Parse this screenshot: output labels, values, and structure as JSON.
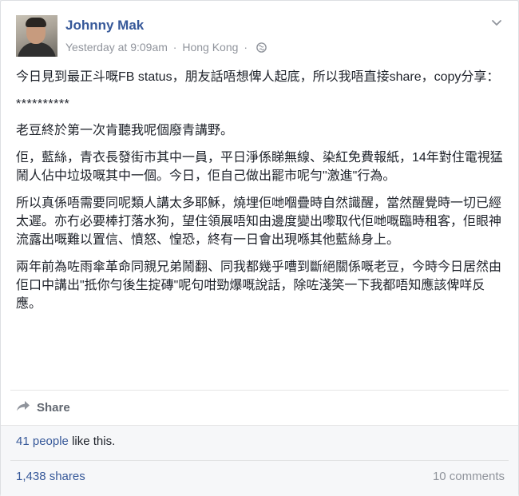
{
  "post": {
    "author": "Johnny Mak",
    "time": "Yesterday at 9:09am",
    "separator1": "·",
    "location": "Hong Kong",
    "separator2": "·",
    "privacy_icon": "globe-icon",
    "options_icon": "chevron-down-icon"
  },
  "body": {
    "paragraphs": [
      "今日見到最正斗嘅FB status，朋友話唔想俾人起底，所以我唔直接share，copy分享：",
      "**********",
      "老豆終於第一次肯聽我呢個廢青講野。",
      "佢，藍絲，青衣長發街市其中一員，平日淨係睇無線、染紅免費報紙，14年對住電視猛鬧人佔中垃圾嘅其中一個。今日，佢自己做出罷市呢勻\"激進\"行為。",
      "所以真係唔需要同呢類人講太多耶穌，燒埋佢哋嗰疊時自然識醒，當然醒覺時一切已經太遲。亦冇必要棒打落水狗，望住領展唔知由邊度變出嚟取代佢哋嘅臨時租客，佢眼神流露出嘅難以置信、憤怒、惶恐，終有一日會出現喺其他藍絲身上。",
      "兩年前為咗雨傘革命同親兄弟鬧翻、同我都幾乎嘈到斷絕關係嘅老豆，今時今日居然由佢口中講出\"抵你勻後生掟磚\"呢句咁勁爆嘅說話，除咗淺笑一下我都唔知應該俾咩反應。"
    ]
  },
  "actions": {
    "share_label": "Share",
    "share_icon": "share-arrow-icon"
  },
  "footer": {
    "likes_link": "41 people",
    "likes_suffix": " like this.",
    "shares": "1,438 shares",
    "comments": "10 comments"
  },
  "colors": {
    "link": "#365899",
    "meta": "#90949c",
    "text": "#1d2129",
    "footer_bg": "#f6f7f9"
  }
}
